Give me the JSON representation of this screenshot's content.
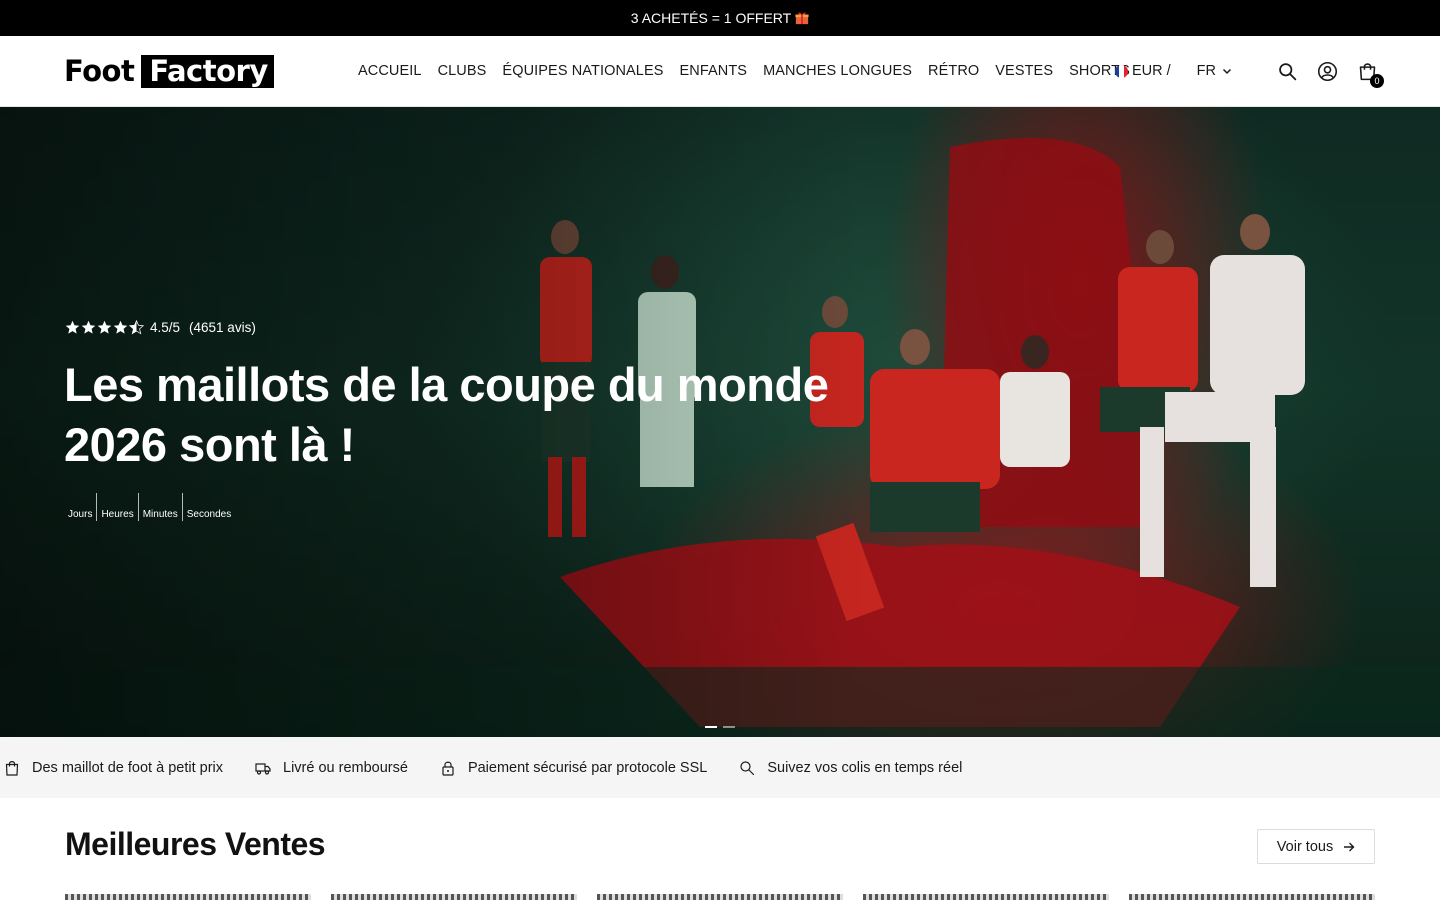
{
  "announcement": {
    "text": "3 ACHETÉS = 1 OFFERT"
  },
  "header": {
    "logo": {
      "part1": "Foot",
      "part2": "Factory"
    },
    "nav": [
      "ACCUEIL",
      "CLUBS",
      "ÉQUIPES NATIONALES",
      "ENFANTS",
      "MANCHES LONGUES",
      "RÉTRO",
      "VESTES",
      "SHORTS"
    ],
    "currency": "EUR /",
    "language": "FR",
    "cart_count": "0"
  },
  "hero": {
    "rating_score": "4.5/5",
    "rating_reviews": "(4651 avis)",
    "stars": 4.5,
    "title": "Les maillots de la coupe du monde 2026 sont là !",
    "countdown_labels": [
      "Jours",
      "Heures",
      "Minutes",
      "Secondes"
    ],
    "slides_total": 2,
    "slide_active": 1
  },
  "features": [
    {
      "icon": "shopping-bag-icon",
      "label": "Des maillot de foot à petit prix"
    },
    {
      "icon": "delivery-truck-icon",
      "label": "Livré ou remboursé"
    },
    {
      "icon": "lock-icon",
      "label": "Paiement sécurisé par protocole SSL"
    },
    {
      "icon": "search-icon",
      "label": "Suivez vos colis en temps réel"
    }
  ],
  "best_sellers": {
    "title": "Meilleures Ventes",
    "view_all": "Voir tous"
  },
  "colors": {
    "accent_red": "#c0141c",
    "dark_green": "#123428",
    "black": "#000000"
  }
}
